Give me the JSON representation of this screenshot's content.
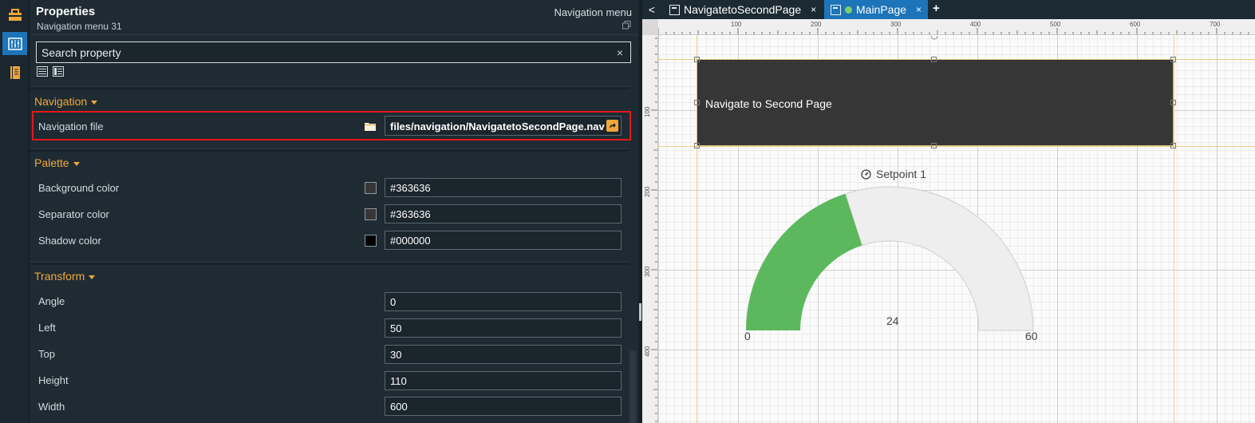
{
  "panel": {
    "title": "Properties",
    "subtitle": "Navigation menu 31",
    "component_type": "Navigation menu",
    "search_placeholder": "Search property",
    "search_clear": "×"
  },
  "sections": {
    "navigation": {
      "title": "Navigation",
      "nav_file_label": "Navigation file",
      "nav_file_value": "files/navigation/NavigatetoSecondPage.nav"
    },
    "palette": {
      "title": "Palette",
      "background_label": "Background color",
      "background_value": "#363636",
      "separator_label": "Separator color",
      "separator_value": "#363636",
      "shadow_label": "Shadow color",
      "shadow_value": "#000000"
    },
    "transform": {
      "title": "Transform",
      "angle_label": "Angle",
      "angle_value": "0",
      "left_label": "Left",
      "left_value": "50",
      "top_label": "Top",
      "top_value": "30",
      "height_label": "Height",
      "height_value": "110",
      "width_label": "Width",
      "width_value": "600"
    }
  },
  "tabs": {
    "back": "<",
    "items": [
      {
        "label": "NavigatetoSecondPage",
        "close": "×"
      },
      {
        "label": "MainPage",
        "close": "×"
      }
    ],
    "add": "+"
  },
  "canvas": {
    "ruler_top": [
      "100",
      "200",
      "300",
      "400",
      "500",
      "600",
      "700"
    ],
    "ruler_left": [
      "100",
      "200",
      "300",
      "400"
    ],
    "nav_menu_text": "Navigate to Second Page",
    "gauge": {
      "title": "Setpoint 1",
      "value": "24",
      "value_number": 24,
      "min_label": "0",
      "max_label": "60",
      "min": 0,
      "max": 60
    }
  },
  "colors": {
    "accent": "#f0a73a",
    "active_tab": "#1d74b8",
    "gauge_fill": "#5cb85c",
    "gauge_track": "#eeeeee",
    "nav_menu_bg": "#363636",
    "highlight": "#e0181c"
  }
}
